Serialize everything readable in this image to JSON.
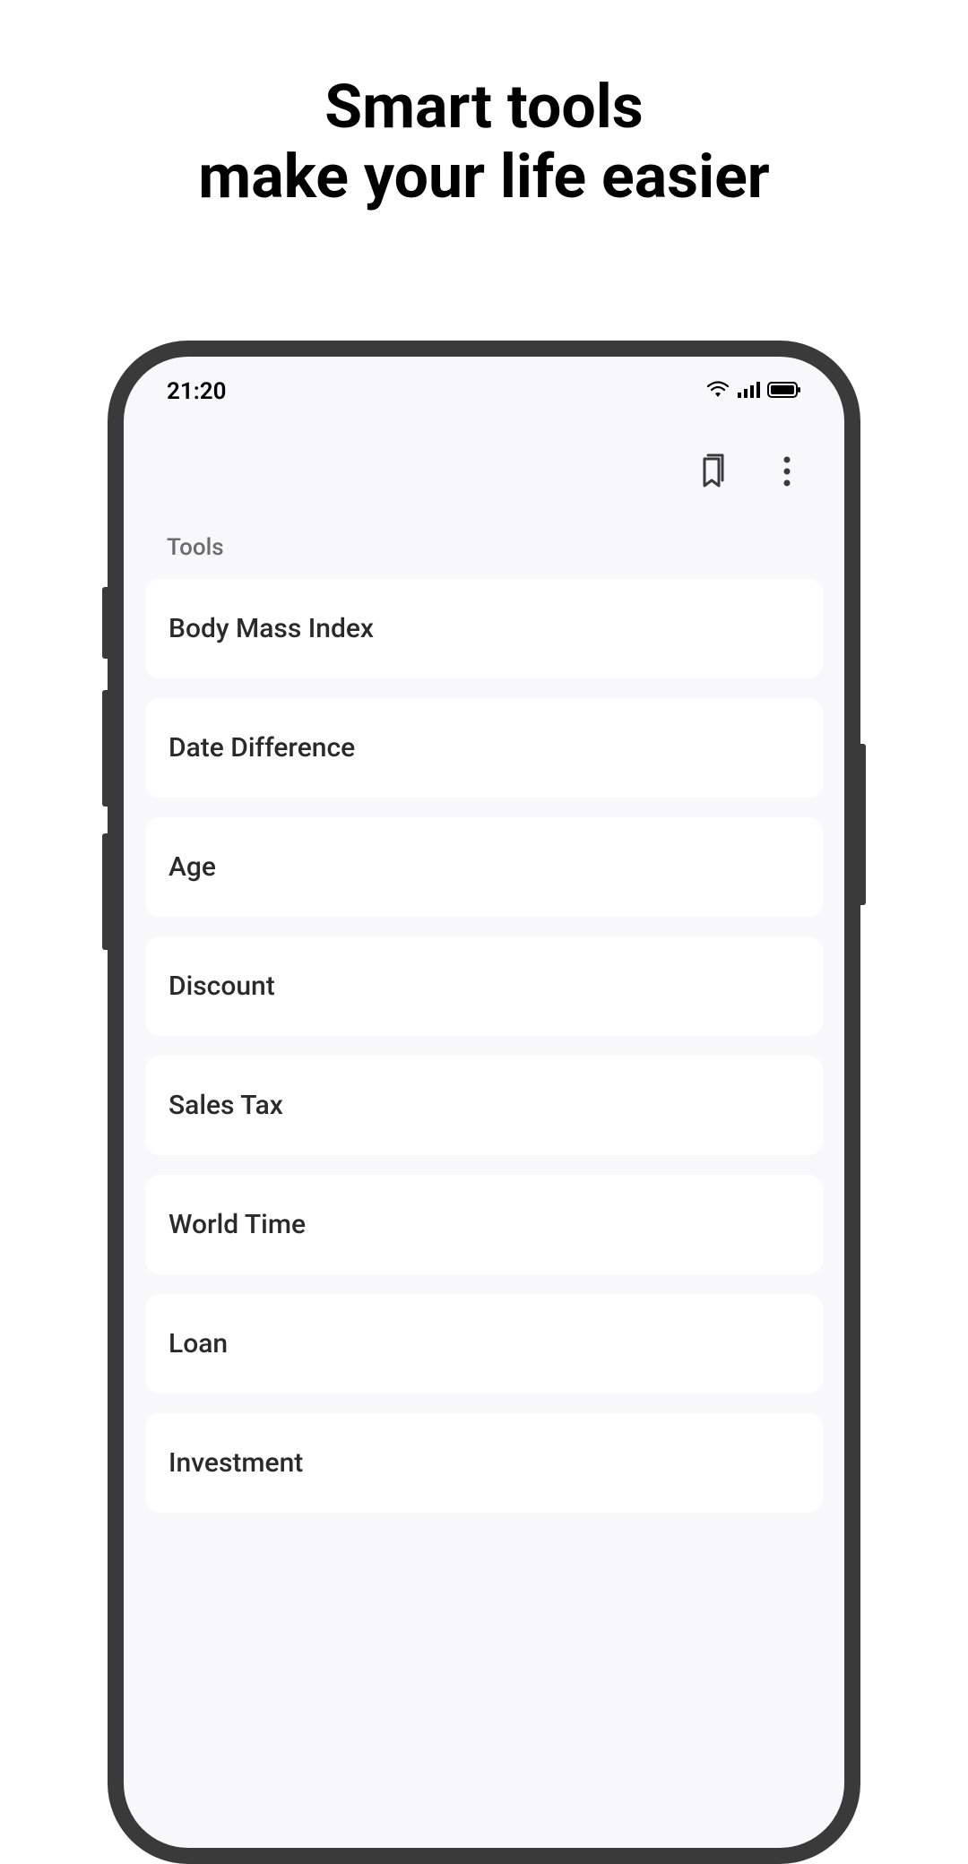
{
  "headline": {
    "line1": "Smart tools",
    "line2": "make your life easier"
  },
  "status_bar": {
    "time": "21:20"
  },
  "section_title": "Tools",
  "tools": [
    {
      "label": "Body Mass Index"
    },
    {
      "label": "Date Difference"
    },
    {
      "label": "Age"
    },
    {
      "label": "Discount"
    },
    {
      "label": "Sales Tax"
    },
    {
      "label": "World Time"
    },
    {
      "label": "Loan"
    },
    {
      "label": "Investment"
    }
  ]
}
